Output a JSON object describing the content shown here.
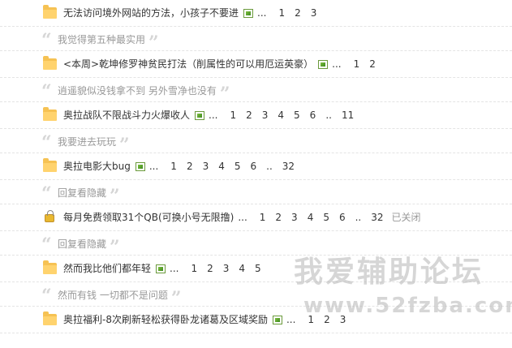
{
  "threads": [
    {
      "kind": "thread",
      "icon": "folder-icon",
      "title": "无法访问境外网站的方法，小孩子不要进",
      "has_image": true,
      "dots": "...",
      "pages": [
        "1",
        "2",
        "3"
      ],
      "status": ""
    },
    {
      "kind": "quote",
      "text": "我觉得第五种最实用"
    },
    {
      "kind": "thread",
      "icon": "folder-icon",
      "title": "<本周>乾坤修罗神贫民打法（削属性的可以用厄运英豪）",
      "has_image": true,
      "dots": "...",
      "pages": [
        "1",
        "2"
      ],
      "status": ""
    },
    {
      "kind": "quote",
      "text": "逍遥貌似没钱拿不到 另外雪净也没有"
    },
    {
      "kind": "thread",
      "icon": "folder-icon",
      "title": "奥拉战队不限战斗力火爆收人",
      "has_image": true,
      "dots": "...",
      "pages": [
        "1",
        "2",
        "3",
        "4",
        "5",
        "6",
        "..",
        "11"
      ],
      "status": ""
    },
    {
      "kind": "quote",
      "text": "我要进去玩玩"
    },
    {
      "kind": "thread",
      "icon": "folder-icon",
      "title": "奥拉电影大bug",
      "has_image": true,
      "dots": "...",
      "pages": [
        "1",
        "2",
        "3",
        "4",
        "5",
        "6",
        "..",
        "32"
      ],
      "status": ""
    },
    {
      "kind": "quote",
      "text": "回复看隐藏"
    },
    {
      "kind": "thread",
      "icon": "lock-icon",
      "title": "每月免费领取31个QB(可换小号无限撸)",
      "has_image": false,
      "dots": "...",
      "pages": [
        "1",
        "2",
        "3",
        "4",
        "5",
        "6",
        "..",
        "32"
      ],
      "status": "已关闭"
    },
    {
      "kind": "quote",
      "text": "回复看隐藏"
    },
    {
      "kind": "thread",
      "icon": "folder-icon",
      "title": "然而我比他们都年轻",
      "has_image": true,
      "dots": "...",
      "pages": [
        "1",
        "2",
        "3",
        "4",
        "5"
      ],
      "status": ""
    },
    {
      "kind": "quote",
      "text": "然而有钱 一切都不是问题"
    },
    {
      "kind": "thread",
      "icon": "folder-icon",
      "title": "奥拉福利-8次刷新轻松获得卧龙诸葛及区域奖励",
      "has_image": true,
      "dots": "...",
      "pages": [
        "1",
        "2",
        "3"
      ],
      "status": ""
    }
  ],
  "quote_marks": {
    "open": "“",
    "close": "”"
  },
  "watermark": {
    "cn": "我爱辅助论坛",
    "url": "www.52fzba.com"
  }
}
